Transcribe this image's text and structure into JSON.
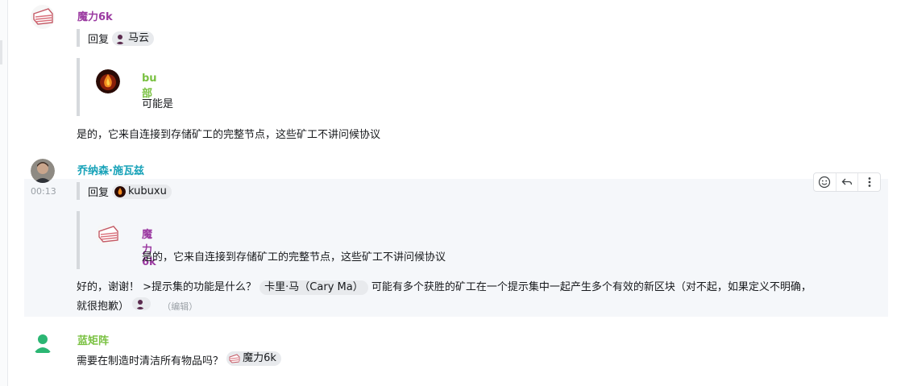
{
  "messages": [
    {
      "sender": "魔力6k",
      "sender_color": "#9b3aa1",
      "reply_prefix": "回复",
      "reply_to": "马云",
      "quoted_sender": "bu部",
      "quoted_sender_color": "#7ac142",
      "quoted_text": "可能是",
      "text": "是的，它来自连接到存储矿工的完整节点，这些矿工不讲问候协议"
    },
    {
      "sender": "乔纳森·施瓦兹",
      "sender_color": "#17a2b8",
      "time": "00:13",
      "reply_prefix": "回复",
      "reply_to": "kubuxu",
      "quoted_sender": "魔力6k",
      "quoted_sender_color": "#9b3aa1",
      "quoted_text": "是的，它来自连接到存储矿工的完整节点，这些矿工不讲问候协议",
      "text_part1": "好的，谢谢！ >提示集的功能是什么？",
      "mention": "卡里·马（Cary Ma）",
      "text_part2": "可能有多个获胜的矿工在一个提示集中一起产生多个有效的新区块（对不起，如果定义不明确，",
      "text_line2": "就很抱歉）",
      "edited": "（编辑）"
    },
    {
      "sender": "蓝矩阵",
      "sender_color": "#7ac142",
      "text": "需要在制造时清洁所有物品吗？",
      "mention": "魔力6k"
    }
  ],
  "toolbar": {
    "icons": [
      "emoji-icon",
      "reply-icon",
      "more-icon"
    ]
  }
}
